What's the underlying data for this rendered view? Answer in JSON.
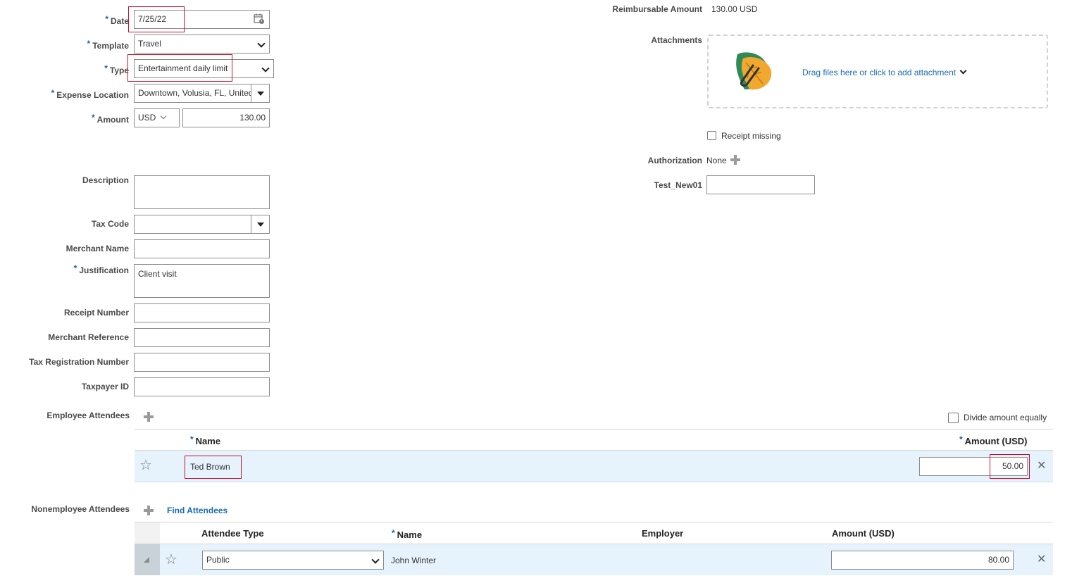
{
  "form": {
    "date": {
      "label": "Date",
      "value": "7/25/22"
    },
    "template": {
      "label": "Template",
      "value": "Travel"
    },
    "type": {
      "label": "Type",
      "value": "Entertainment daily limit"
    },
    "expense_location": {
      "label": "Expense Location",
      "value": "Downtown, Volusia, FL, United"
    },
    "amount": {
      "label": "Amount",
      "currency": "USD",
      "value": "130.00"
    },
    "description": {
      "label": "Description",
      "value": ""
    },
    "tax_code": {
      "label": "Tax Code",
      "value": ""
    },
    "merchant_name": {
      "label": "Merchant Name",
      "value": ""
    },
    "justification": {
      "label": "Justification",
      "value": "Client visit"
    },
    "receipt_number": {
      "label": "Receipt Number",
      "value": ""
    },
    "merchant_reference": {
      "label": "Merchant Reference",
      "value": ""
    },
    "tax_registration_number": {
      "label": "Tax Registration Number",
      "value": ""
    },
    "taxpayer_id": {
      "label": "Taxpayer ID",
      "value": ""
    },
    "required_marker": "*"
  },
  "right": {
    "reimbursable_label": "Reimbursable Amount",
    "reimbursable_value": "130.00 USD",
    "attachments_label": "Attachments",
    "attachment_prompt": "Drag files here or click to add attachment",
    "receipt_missing_label": "Receipt missing",
    "authorization_label": "Authorization",
    "authorization_value": "None",
    "test_label": "Test_New01",
    "test_value": ""
  },
  "employee_attendees": {
    "label": "Employee Attendees",
    "divide_label": "Divide amount equally",
    "headers": {
      "name": "Name",
      "amount": "Amount (USD)"
    },
    "rows": [
      {
        "name": "Ted Brown",
        "amount": "50.00"
      }
    ]
  },
  "nonemployee_attendees": {
    "label": "Nonemployee Attendees",
    "find_label": "Find Attendees",
    "headers": {
      "attendee_type": "Attendee Type",
      "name": "Name",
      "employer": "Employer",
      "amount": "Amount (USD)"
    },
    "rows": [
      {
        "attendee_type": "Public",
        "name": "John Winter",
        "employer": "",
        "amount": "80.00"
      }
    ]
  },
  "colors": {
    "highlight_border": "#c8102e",
    "link": "#1b6bb0",
    "row_selected": "#e6f2fc",
    "required": "#1a5fa8"
  }
}
